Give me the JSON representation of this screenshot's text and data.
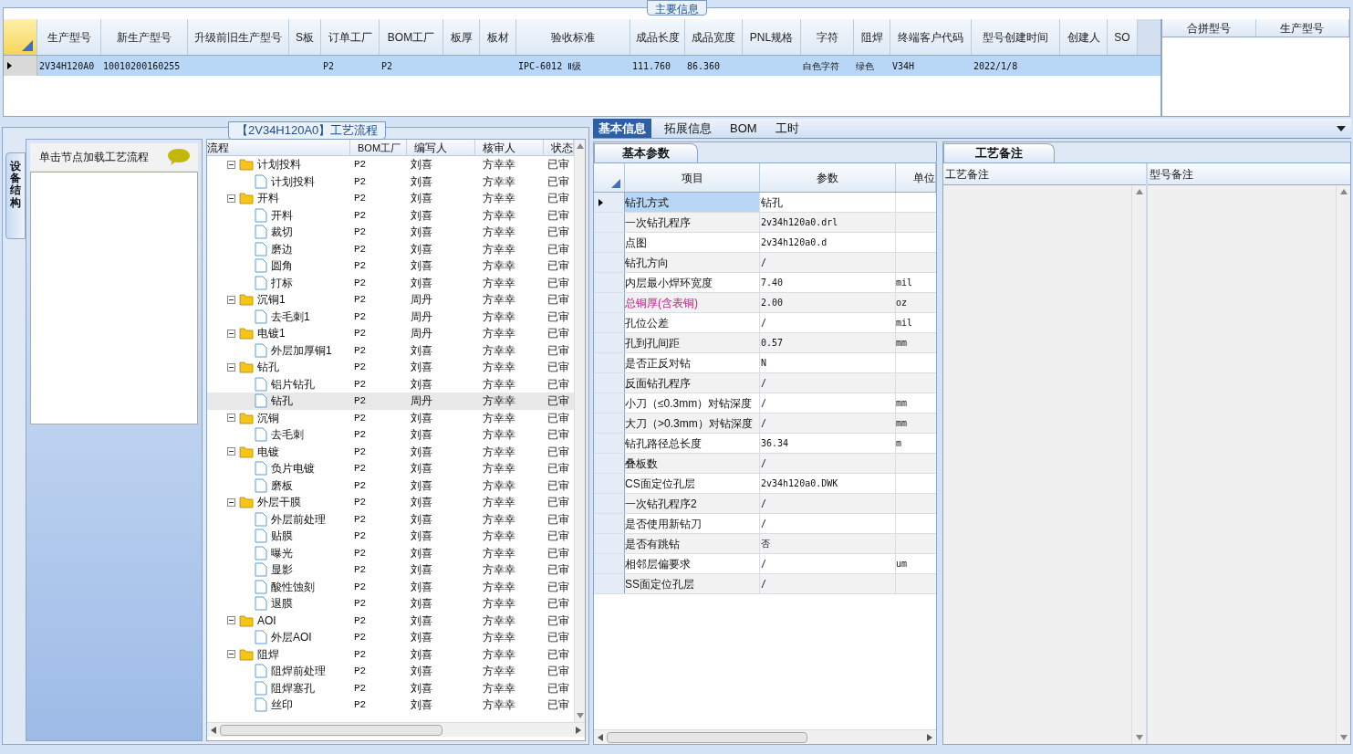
{
  "main_panel": {
    "title": "主要信息",
    "columns": [
      "生产型号",
      "新生产型号",
      "升级前旧生产型号",
      "S板",
      "订单工厂",
      "BOM工厂",
      "板厚",
      "板材",
      "验收标准",
      "成品长度",
      "成品宽度",
      "PNL规格",
      "字符",
      "阻焊",
      "终端客户代码",
      "型号创建时间",
      "创建人",
      "SO"
    ],
    "rows": [
      {
        "selected": true,
        "cells": [
          "2V34H120A0",
          "10010200160255",
          "",
          "",
          "P2",
          "P2",
          "",
          "",
          "IPC-6012 Ⅱ级",
          "111.760",
          "86.360",
          "",
          "白色字符",
          "绿色",
          "V34H",
          "2022/1/8",
          "",
          ""
        ]
      }
    ],
    "side_columns": [
      "合拼型号",
      "生产型号"
    ]
  },
  "left_panel": {
    "vertical_tab": "设备结构",
    "hint": "单击节点加载工艺流程"
  },
  "flow_panel": {
    "title": "【2V34H120A0】工艺流程",
    "columns": [
      "流程",
      "BOM工厂",
      "编写人",
      "核审人",
      "状态"
    ],
    "tree": [
      {
        "name": "计划投料",
        "bom": "P2",
        "writer": "刘喜",
        "reviewer": "方幸幸",
        "status": "已审",
        "expanded": true,
        "selected": false,
        "children": [
          {
            "name": "计划投料",
            "bom": "P2",
            "writer": "刘喜",
            "reviewer": "方幸幸",
            "status": "已审",
            "selected": false
          }
        ]
      },
      {
        "name": "开料",
        "bom": "P2",
        "writer": "刘喜",
        "reviewer": "方幸幸",
        "status": "已审",
        "expanded": true,
        "selected": false,
        "children": [
          {
            "name": "开料",
            "bom": "P2",
            "writer": "刘喜",
            "reviewer": "方幸幸",
            "status": "已审",
            "selected": false
          },
          {
            "name": "裁切",
            "bom": "P2",
            "writer": "刘喜",
            "reviewer": "方幸幸",
            "status": "已审",
            "selected": false
          },
          {
            "name": "磨边",
            "bom": "P2",
            "writer": "刘喜",
            "reviewer": "方幸幸",
            "status": "已审",
            "selected": false
          },
          {
            "name": "圆角",
            "bom": "P2",
            "writer": "刘喜",
            "reviewer": "方幸幸",
            "status": "已审",
            "selected": false
          },
          {
            "name": "打标",
            "bom": "P2",
            "writer": "刘喜",
            "reviewer": "方幸幸",
            "status": "已审",
            "selected": false
          }
        ]
      },
      {
        "name": "沉铜1",
        "bom": "P2",
        "writer": "周丹",
        "reviewer": "方幸幸",
        "status": "已审",
        "expanded": true,
        "selected": false,
        "children": [
          {
            "name": "去毛刺1",
            "bom": "P2",
            "writer": "周丹",
            "reviewer": "方幸幸",
            "status": "已审",
            "selected": false
          }
        ]
      },
      {
        "name": "电镀1",
        "bom": "P2",
        "writer": "周丹",
        "reviewer": "方幸幸",
        "status": "已审",
        "expanded": true,
        "selected": false,
        "children": [
          {
            "name": "外层加厚铜1",
            "bom": "P2",
            "writer": "刘喜",
            "reviewer": "方幸幸",
            "status": "已审",
            "selected": false
          }
        ]
      },
      {
        "name": "钻孔",
        "bom": "P2",
        "writer": "刘喜",
        "reviewer": "方幸幸",
        "status": "已审",
        "expanded": true,
        "selected": false,
        "children": [
          {
            "name": "铝片钻孔",
            "bom": "P2",
            "writer": "刘喜",
            "reviewer": "方幸幸",
            "status": "已审",
            "selected": false
          },
          {
            "name": "钻孔",
            "bom": "P2",
            "writer": "周丹",
            "reviewer": "方幸幸",
            "status": "已审",
            "selected": true
          }
        ]
      },
      {
        "name": "沉铜",
        "bom": "P2",
        "writer": "刘喜",
        "reviewer": "方幸幸",
        "status": "已审",
        "expanded": true,
        "selected": false,
        "children": [
          {
            "name": "去毛刺",
            "bom": "P2",
            "writer": "刘喜",
            "reviewer": "方幸幸",
            "status": "已审",
            "selected": false
          }
        ]
      },
      {
        "name": "电镀",
        "bom": "P2",
        "writer": "刘喜",
        "reviewer": "方幸幸",
        "status": "已审",
        "expanded": true,
        "selected": false,
        "children": [
          {
            "name": "负片电镀",
            "bom": "P2",
            "writer": "刘喜",
            "reviewer": "方幸幸",
            "status": "已审",
            "selected": false
          },
          {
            "name": "磨板",
            "bom": "P2",
            "writer": "刘喜",
            "reviewer": "方幸幸",
            "status": "已审",
            "selected": false
          }
        ]
      },
      {
        "name": "外层干膜",
        "bom": "P2",
        "writer": "刘喜",
        "reviewer": "方幸幸",
        "status": "已审",
        "expanded": true,
        "selected": false,
        "children": [
          {
            "name": "外层前处理",
            "bom": "P2",
            "writer": "刘喜",
            "reviewer": "方幸幸",
            "status": "已审",
            "selected": false
          },
          {
            "name": "贴膜",
            "bom": "P2",
            "writer": "刘喜",
            "reviewer": "方幸幸",
            "status": "已审",
            "selected": false
          },
          {
            "name": "曝光",
            "bom": "P2",
            "writer": "刘喜",
            "reviewer": "方幸幸",
            "status": "已审",
            "selected": false
          },
          {
            "name": "显影",
            "bom": "P2",
            "writer": "刘喜",
            "reviewer": "方幸幸",
            "status": "已审",
            "selected": false
          },
          {
            "name": "酸性蚀刻",
            "bom": "P2",
            "writer": "刘喜",
            "reviewer": "方幸幸",
            "status": "已审",
            "selected": false
          },
          {
            "name": "退膜",
            "bom": "P2",
            "writer": "刘喜",
            "reviewer": "方幸幸",
            "status": "已审",
            "selected": false
          }
        ]
      },
      {
        "name": "AOI",
        "bom": "P2",
        "writer": "刘喜",
        "reviewer": "方幸幸",
        "status": "已审",
        "expanded": true,
        "selected": false,
        "children": [
          {
            "name": "外层AOI",
            "bom": "P2",
            "writer": "刘喜",
            "reviewer": "方幸幸",
            "status": "已审",
            "selected": false
          }
        ]
      },
      {
        "name": "阻焊",
        "bom": "P2",
        "writer": "刘喜",
        "reviewer": "方幸幸",
        "status": "已审",
        "expanded": true,
        "selected": false,
        "children": [
          {
            "name": "阻焊前处理",
            "bom": "P2",
            "writer": "刘喜",
            "reviewer": "方幸幸",
            "status": "已审",
            "selected": false
          },
          {
            "name": "阻焊塞孔",
            "bom": "P2",
            "writer": "刘喜",
            "reviewer": "方幸幸",
            "status": "已审",
            "selected": false
          },
          {
            "name": "丝印",
            "bom": "P2",
            "writer": "刘喜",
            "reviewer": "方幸幸",
            "status": "已审",
            "selected": false
          }
        ]
      }
    ]
  },
  "tabs": [
    {
      "label": "基本信息",
      "selected": true
    },
    {
      "label": "拓展信息",
      "selected": false
    },
    {
      "label": "BOM",
      "selected": false
    },
    {
      "label": "工时",
      "selected": false
    }
  ],
  "params_panel": {
    "tab": "基本参数",
    "columns": [
      "项目",
      "参数",
      "单位"
    ],
    "rows": [
      {
        "item": "钻孔方式",
        "value": "钻孔",
        "unit": "",
        "selected": true,
        "highlighted": false
      },
      {
        "item": "一次钻孔程序",
        "value": "2v34h120a0.drl",
        "unit": "",
        "selected": false,
        "highlighted": false
      },
      {
        "item": "点图",
        "value": "2v34h120a0.d",
        "unit": "",
        "selected": false,
        "highlighted": false
      },
      {
        "item": "钻孔方向",
        "value": "/",
        "unit": "",
        "selected": false,
        "highlighted": false
      },
      {
        "item": "内层最小焊环宽度",
        "value": "7.40",
        "unit": "mil",
        "selected": false,
        "highlighted": false
      },
      {
        "item": "总铜厚(含表铜)",
        "value": "2.00",
        "unit": "oz",
        "selected": false,
        "highlighted": true
      },
      {
        "item": "孔位公差",
        "value": "/",
        "unit": "mil",
        "selected": false,
        "highlighted": false
      },
      {
        "item": "孔到孔间距",
        "value": "0.57",
        "unit": "mm",
        "selected": false,
        "highlighted": false
      },
      {
        "item": "是否正反对钻",
        "value": "N",
        "unit": "",
        "selected": false,
        "highlighted": false
      },
      {
        "item": "反面钻孔程序",
        "value": "/",
        "unit": "",
        "selected": false,
        "highlighted": false
      },
      {
        "item": "小刀（≤0.3mm）对钻深度",
        "value": "/",
        "unit": "mm",
        "selected": false,
        "highlighted": false
      },
      {
        "item": "大刀（>0.3mm）对钻深度",
        "value": "/",
        "unit": "mm",
        "selected": false,
        "highlighted": false
      },
      {
        "item": "钻孔路径总长度",
        "value": "36.34",
        "unit": "m",
        "selected": false,
        "highlighted": false
      },
      {
        "item": "叠板数",
        "value": "/",
        "unit": "",
        "selected": false,
        "highlighted": false
      },
      {
        "item": "CS面定位孔层",
        "value": "2v34h120a0.DWK",
        "unit": "",
        "selected": false,
        "highlighted": false
      },
      {
        "item": "一次钻孔程序2",
        "value": "/",
        "unit": "",
        "selected": false,
        "highlighted": false
      },
      {
        "item": "是否使用新钻刀",
        "value": "/",
        "unit": "",
        "selected": false,
        "highlighted": false
      },
      {
        "item": "是否有跳钻",
        "value": "否",
        "unit": "",
        "selected": false,
        "highlighted": false
      },
      {
        "item": "相邻层偏要求",
        "value": "/",
        "unit": "um",
        "selected": false,
        "highlighted": false
      },
      {
        "item": "SS面定位孔层",
        "value": "/",
        "unit": "",
        "selected": false,
        "highlighted": false
      }
    ]
  },
  "notes_panel": {
    "tab": "工艺备注",
    "columns": [
      "工艺备注",
      "型号备注"
    ]
  }
}
